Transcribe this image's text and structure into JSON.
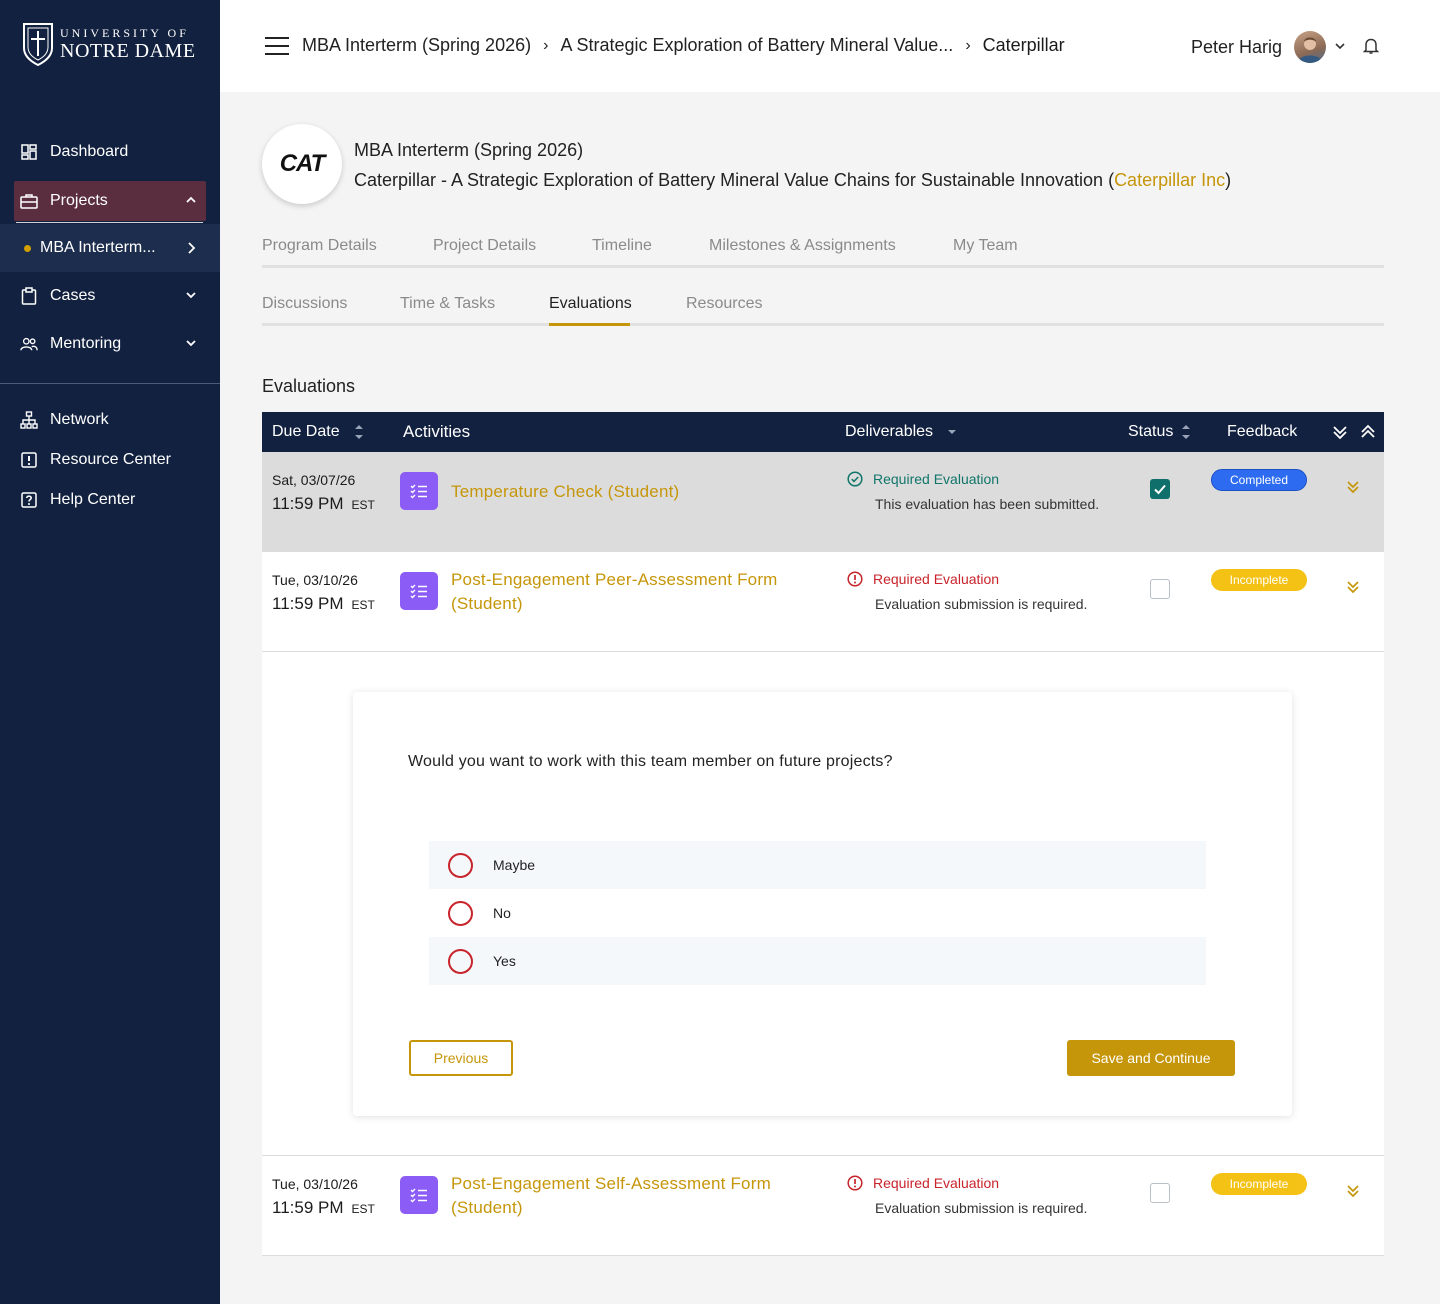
{
  "brand": {
    "line1": "UNIVERSITY OF",
    "line2": "NOTRE DAME"
  },
  "sidebar": {
    "items": [
      {
        "label": "Dashboard",
        "icon": "dashboard-icon"
      },
      {
        "label": "Projects",
        "icon": "briefcase-icon"
      },
      {
        "label": "Cases",
        "icon": "clipboard-icon"
      },
      {
        "label": "Mentoring",
        "icon": "people-icon"
      },
      {
        "label": "Network",
        "icon": "network-icon"
      },
      {
        "label": "Resource Center",
        "icon": "alert-box-icon"
      },
      {
        "label": "Help Center",
        "icon": "help-box-icon"
      }
    ],
    "sub_item": "MBA Interterm..."
  },
  "header": {
    "breadcrumb": [
      "MBA Interterm (Spring 2026)",
      "A Strategic Exploration of Battery Mineral Value...",
      "Caterpillar"
    ],
    "user_name": "Peter Harig"
  },
  "project": {
    "logo_text": "CAT",
    "program": "MBA Interterm (Spring 2026)",
    "title_prefix": "Caterpillar - A Strategic Exploration of Battery Mineral Value Chains for Sustainable Innovation (",
    "company": "Caterpillar Inc",
    "title_suffix": ")"
  },
  "tabs_row1": [
    "Program Details",
    "Project Details",
    "Timeline",
    "Milestones & Assignments",
    "My Team"
  ],
  "tabs_row2": [
    "Discussions",
    "Time & Tasks",
    "Evaluations",
    "Resources"
  ],
  "active_tab": "Evaluations",
  "section_title": "Evaluations",
  "table": {
    "headers": {
      "due_date": "Due Date",
      "activities": "Activities",
      "deliverables": "Deliverables",
      "status": "Status",
      "feedback": "Feedback"
    },
    "rows": [
      {
        "date": "Sat, 03/07/26",
        "time": "11:59 PM",
        "tz": "EST",
        "activity": "Temperature Check (Student)",
        "deliverable_title": "Required Evaluation",
        "deliverable_sub": "This evaluation has been submitted.",
        "checked": true,
        "badge": "Completed"
      },
      {
        "date": "Tue, 03/10/26",
        "time": "11:59 PM",
        "tz": "EST",
        "activity_line1": "Post-Engagement Peer-Assessment Form",
        "activity_line2": "(Student)",
        "deliverable_title": "Required Evaluation",
        "deliverable_sub": "Evaluation submission is required.",
        "checked": false,
        "badge": "Incomplete"
      },
      {
        "date": "Tue, 03/10/26",
        "time": "11:59 PM",
        "tz": "EST",
        "activity_line1": "Post-Engagement Self-Assessment Form",
        "activity_line2": "(Student)",
        "deliverable_title": "Required Evaluation",
        "deliverable_sub": "Evaluation submission is required.",
        "checked": false,
        "badge": "Incomplete"
      }
    ]
  },
  "form": {
    "question": "Would you want to work with this team member on future projects?",
    "options": [
      "Maybe",
      "No",
      "Yes"
    ],
    "previous": "Previous",
    "save": "Save and Continue"
  },
  "colors": {
    "navy": "#12213f",
    "gold": "#c6960a",
    "purple": "#8b5cf6",
    "teal": "#10766a",
    "red": "#c8242b",
    "blue": "#2d6cf0",
    "yellow": "#f4c115"
  }
}
